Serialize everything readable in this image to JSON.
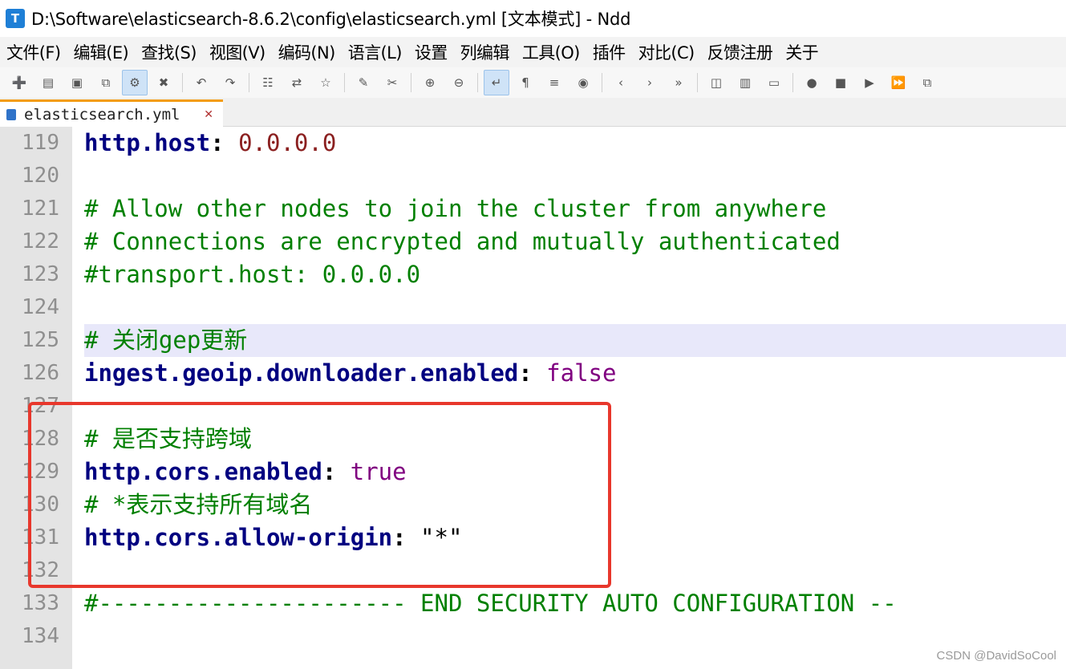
{
  "window": {
    "title": "D:\\Software\\elasticsearch-8.6.2\\config\\elasticsearch.yml [文本模式] - Ndd",
    "app_icon": "T"
  },
  "menu": [
    "文件(F)",
    "编辑(E)",
    "查找(S)",
    "视图(V)",
    "编码(N)",
    "语言(L)",
    "设置",
    "列编辑",
    "工具(O)",
    "插件",
    "对比(C)",
    "反馈注册",
    "关于"
  ],
  "toolbar": {
    "icons": [
      {
        "name": "new-file-icon",
        "glyph": "➕"
      },
      {
        "name": "open-file-icon",
        "glyph": "▤"
      },
      {
        "name": "save-icon",
        "glyph": "▣"
      },
      {
        "name": "save-all-icon",
        "glyph": "⧉"
      },
      {
        "name": "settings-icon",
        "glyph": "⚙"
      },
      {
        "name": "close-file-icon",
        "glyph": "✖"
      },
      {
        "name": "undo-icon",
        "glyph": "↶"
      },
      {
        "name": "redo-icon",
        "glyph": "↷"
      },
      {
        "name": "find-icon",
        "glyph": "☷"
      },
      {
        "name": "replace-icon",
        "glyph": "⇄"
      },
      {
        "name": "bookmark-icon",
        "glyph": "☆"
      },
      {
        "name": "marker-icon",
        "glyph": "✎"
      },
      {
        "name": "eraser-icon",
        "glyph": "✂"
      },
      {
        "name": "zoom-in-icon",
        "glyph": "⊕"
      },
      {
        "name": "zoom-out-icon",
        "glyph": "⊖"
      },
      {
        "name": "word-wrap-icon",
        "glyph": "↵"
      },
      {
        "name": "show-symbols-icon",
        "glyph": "¶"
      },
      {
        "name": "indent-guide-icon",
        "glyph": "≡"
      },
      {
        "name": "target-icon",
        "glyph": "◉"
      },
      {
        "name": "prev-icon",
        "glyph": "‹"
      },
      {
        "name": "next-icon",
        "glyph": "›"
      },
      {
        "name": "goto-icon",
        "glyph": "»"
      },
      {
        "name": "columns-icon",
        "glyph": "◫"
      },
      {
        "name": "compare-icon",
        "glyph": "▥"
      },
      {
        "name": "monitor-icon",
        "glyph": "▭"
      },
      {
        "name": "record-macro-icon",
        "glyph": "●"
      },
      {
        "name": "stop-macro-icon",
        "glyph": "■"
      },
      {
        "name": "play-macro-icon",
        "glyph": "▶"
      },
      {
        "name": "run-multiple-icon",
        "glyph": "⏩"
      },
      {
        "name": "save-macro-icon",
        "glyph": "⧉"
      }
    ]
  },
  "tab": {
    "label": "elasticsearch.yml",
    "close_glyph": "✕"
  },
  "lines": [
    {
      "n": "119",
      "tokens": [
        {
          "t": "http.host",
          "c": "key"
        },
        {
          "t": ": ",
          "c": "colon"
        },
        {
          "t": "0.0.0.0",
          "c": "num"
        }
      ]
    },
    {
      "n": "120",
      "tokens": []
    },
    {
      "n": "121",
      "tokens": [
        {
          "t": "# Allow other nodes to join the cluster from anywhere",
          "c": "cmt"
        }
      ]
    },
    {
      "n": "122",
      "tokens": [
        {
          "t": "# Connections are encrypted and mutually authenticated",
          "c": "cmt"
        }
      ]
    },
    {
      "n": "123",
      "tokens": [
        {
          "t": "#transport.host: 0.0.0.0",
          "c": "cmt"
        }
      ]
    },
    {
      "n": "124",
      "tokens": []
    },
    {
      "n": "125",
      "tokens": [
        {
          "t": "# 关闭gep更新",
          "c": "cmt"
        }
      ],
      "highlight": true
    },
    {
      "n": "126",
      "tokens": [
        {
          "t": "ingest.geoip.downloader.enabled",
          "c": "key"
        },
        {
          "t": ": ",
          "c": "colon"
        },
        {
          "t": "false",
          "c": "kw"
        }
      ]
    },
    {
      "n": "127",
      "tokens": []
    },
    {
      "n": "128",
      "tokens": [
        {
          "t": "# 是否支持跨域",
          "c": "cmt"
        }
      ]
    },
    {
      "n": "129",
      "tokens": [
        {
          "t": "http.cors.enabled",
          "c": "key"
        },
        {
          "t": ": ",
          "c": "colon"
        },
        {
          "t": "true",
          "c": "kw"
        }
      ]
    },
    {
      "n": "130",
      "tokens": [
        {
          "t": "# *表示支持所有域名",
          "c": "cmt"
        }
      ]
    },
    {
      "n": "131",
      "tokens": [
        {
          "t": "http.cors.allow-origin",
          "c": "key"
        },
        {
          "t": ": ",
          "c": "colon"
        },
        {
          "t": "\"*\"",
          "c": "str"
        }
      ]
    },
    {
      "n": "132",
      "tokens": []
    },
    {
      "n": "133",
      "tokens": [
        {
          "t": "#---------------------- END SECURITY AUTO CONFIGURATION --",
          "c": "cmt"
        }
      ]
    },
    {
      "n": "134",
      "tokens": []
    }
  ],
  "watermark": "CSDN @DavidSoCool"
}
